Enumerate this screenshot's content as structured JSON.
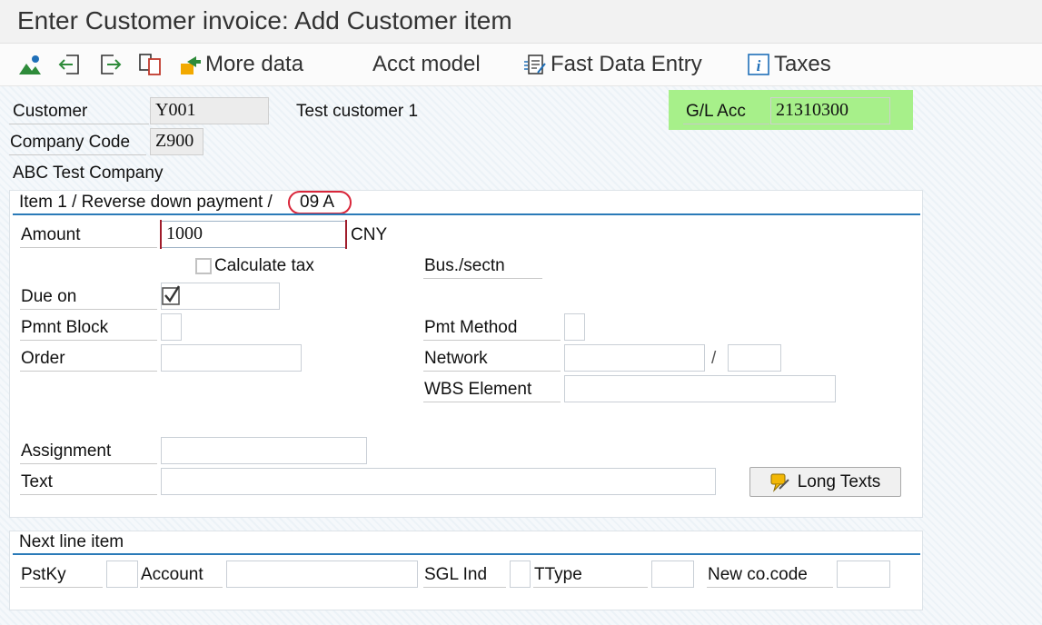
{
  "window": {
    "title": "Enter Customer invoice: Add Customer item"
  },
  "toolbar": {
    "more_data": "More data",
    "acct_model": "Acct model",
    "fast_data_entry": "Fast Data Entry",
    "taxes": "Taxes"
  },
  "header": {
    "customer_label": "Customer",
    "customer_value": "Y001",
    "customer_name": "Test customer 1",
    "gl_acc_label": "G/L Acc",
    "gl_acc_value": "21310300",
    "company_code_label": "Company Code",
    "company_code_value": "Z900",
    "company_name": "ABC Test Company"
  },
  "item": {
    "section_title": "Item 1 / Reverse down payment /",
    "posting_key_code": "09 A",
    "amount_label": "Amount",
    "amount_value": "1000",
    "currency": "CNY",
    "calculate_tax_label": "Calculate tax",
    "calculate_tax_checked": false,
    "bus_sectn_label": "Bus./sectn",
    "due_on_label": "Due on",
    "pmnt_block_label": "Pmnt Block",
    "pmt_method_label": "Pmt Method",
    "order_label": "Order",
    "network_label": "Network",
    "network_sep": "/",
    "wbs_label": "WBS Element",
    "assignment_label": "Assignment",
    "text_label": "Text",
    "long_texts_button": "Long Texts"
  },
  "next_line": {
    "section_title": "Next line item",
    "pstky_label": "PstKy",
    "account_label": "Account",
    "sgl_ind_label": "SGL Ind",
    "ttype_label": "TType",
    "new_cocode_label": "New co.code"
  },
  "colors": {
    "accent_line": "#2a7ab8",
    "gl_highlight": "#a7f08a",
    "annotation_red": "#d9263a"
  },
  "icons": [
    "display-icon",
    "previous-item-icon",
    "next-item-icon",
    "copy-icon",
    "more-data-icon",
    "fast-data-entry-icon",
    "taxes-info-icon",
    "long-texts-icon"
  ]
}
